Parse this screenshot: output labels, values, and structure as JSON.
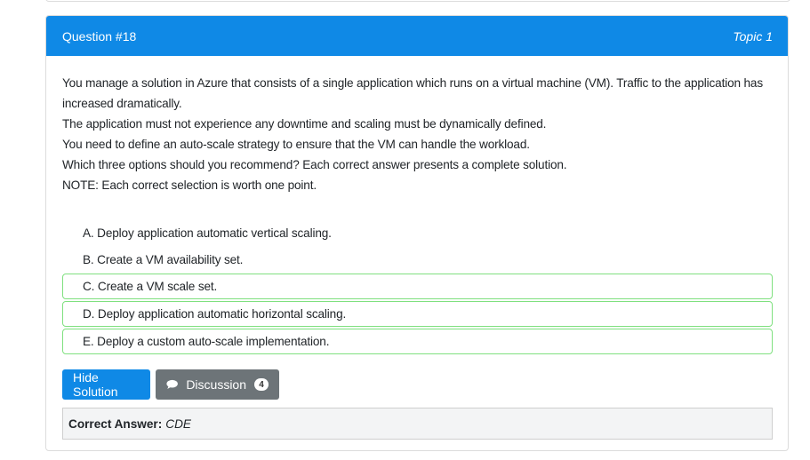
{
  "question": {
    "number_label": "Question #18",
    "topic_label": "Topic 1",
    "text_lines": [
      "You manage a solution in Azure that consists of a single application which runs on a virtual machine (VM). Traffic to the application has increased dramatically.",
      "The application must not experience any downtime and scaling must be dynamically defined.",
      "You need to define an auto-scale strategy to ensure that the VM can handle the workload.",
      "Which three options should you recommend? Each correct answer presents a complete solution.",
      "NOTE: Each correct selection is worth one point."
    ]
  },
  "choices": [
    {
      "label": "A. Deploy application automatic vertical scaling.",
      "correct": false
    },
    {
      "label": "B. Create a VM availability set.",
      "correct": false
    },
    {
      "label": "C. Create a VM scale set.",
      "correct": true
    },
    {
      "label": "D. Deploy application automatic horizontal scaling.",
      "correct": true
    },
    {
      "label": "E. Deploy a custom auto-scale implementation.",
      "correct": true
    }
  ],
  "buttons": {
    "hide_solution": "Hide Solution",
    "discussion": "Discussion",
    "discussion_count": "4"
  },
  "answer": {
    "label": "Correct Answer:",
    "value": "CDE"
  },
  "colors": {
    "header_bg": "#0f89e6",
    "correct_border": "#7fe07f",
    "discussion_bg": "#6d7478"
  },
  "icons": {
    "discussion": "chat-bubble-icon"
  }
}
